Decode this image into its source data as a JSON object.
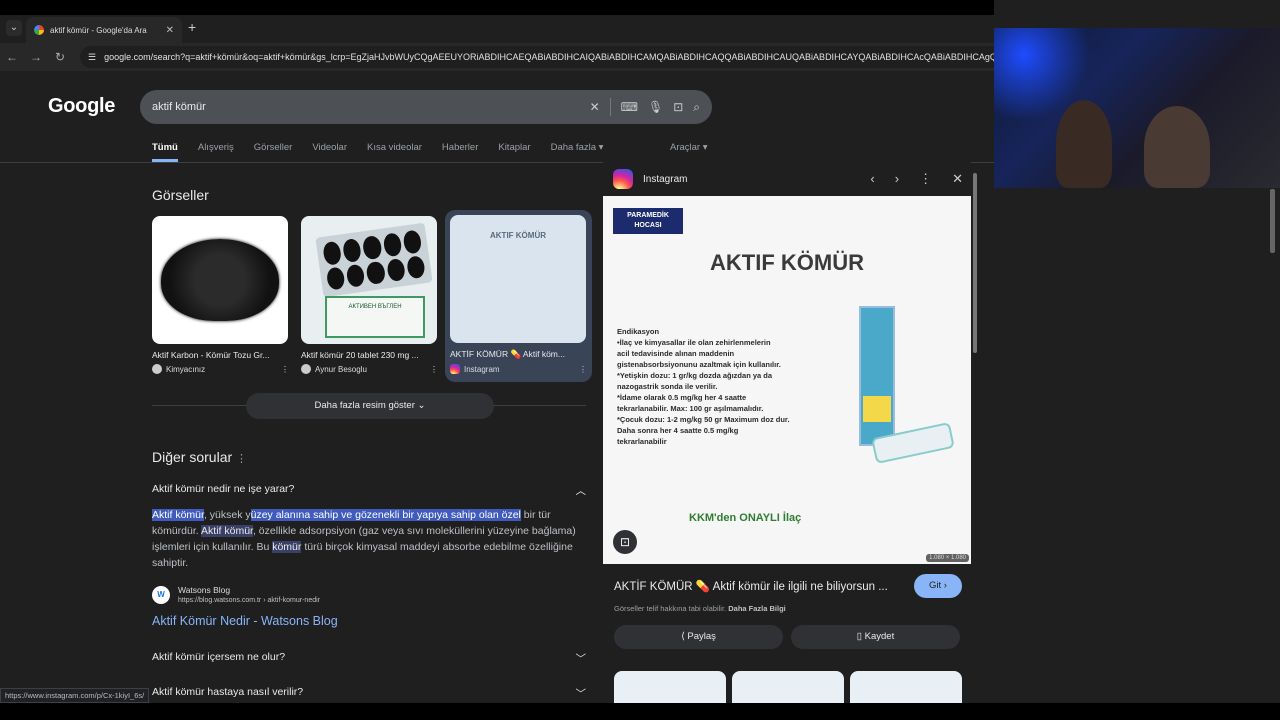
{
  "browser": {
    "tab_title": "aktif kömür - Google'da Ara",
    "url": "google.com/search?q=aktif+kömür&oq=aktif+kömür&gs_lcrp=EgZjaHJvbWUyCQgAEEUYORiABDIHCAEQABiABDIHCAIQABiABDIHCAMQABiABDIHCAQQABiABDIHCAUQABiABDIHCAYQABiABDIHCAcQABiABDIHCAgQABiABDIHCAkQABiABDIHCAoQABiABDIHCAsQABiABNIB"
  },
  "google": {
    "logo": "Google",
    "query": "aktif kömür",
    "filters": [
      "Tümü",
      "Alışveriş",
      "Görseller",
      "Videolar",
      "Kısa videolar",
      "Haberler",
      "Kitaplar",
      "Daha fazla ▾"
    ],
    "tools": "Araçlar ▾"
  },
  "images_section": {
    "heading": "Görseller",
    "cards": [
      {
        "title": "Aktif Karbon - Kömür Tozu Gr...",
        "source": "Kimyacınız"
      },
      {
        "title": "Aktif kömür 20 tablet 230 mg ...",
        "source": "Aynur Besoglu",
        "box_text": "АКТИВЕН ВЪГЛЕН"
      },
      {
        "title": "AKTİF KÖMÜR 💊 Aktif köm...",
        "source": "Instagram",
        "thumb_text": "AKTIF KÖMÜR"
      }
    ],
    "more_button": "Daha fazla resim göster ⌄"
  },
  "questions": {
    "heading": "Diğer sorular",
    "q1": "Aktif kömür nedir ne işe yarar?",
    "answer": {
      "a": "Aktif kömür",
      "b": ", yüksek y",
      "c": "üzey alanına sahip ve gözenekli bir yapıya sahip olan özel",
      "d": " bir tür kömürdür. ",
      "e": "Aktif kömür",
      "f": ", özellikle adsorpsiyon (gaz veya sıvı moleküllerini yüzeyine bağlama) işlemleri için kullanılır. Bu ",
      "g": "kömür",
      "h": " türü birçok kimyasal maddeyi absorbe edebilme özelliğine sahiptir."
    },
    "source_name": "Watsons Blog",
    "source_url": "https://blog.watsons.com.tr › aktif-komur-nedir",
    "source_link": "Aktif Kömür Nedir - Watsons Blog",
    "q2": "Aktif kömür içersem ne olur?",
    "q3": "Aktif kömür hastaya nasıl verilir?"
  },
  "panel": {
    "site": "Instagram",
    "badge": "PARAMEDİK HOCASI",
    "image_title": "AKTIF KÖMÜR",
    "image_text": [
      "Endikasyon",
      "•İlaç ve kimyasallar ile olan zehirlenmelerin",
      "acil tedavisinde alınan maddenin",
      "gistenabsorbsiyonunu azaltmak için kullanılır.",
      "*Yetişkin dozu: 1 gr/kg dozda ağızdan ya da",
      "nazogastrik sonda ile verilir.",
      "*İdame olarak 0.5 mg/kg her 4 saatte",
      "tekrarlanabilir. Max: 100 gr aşılmamalıdır.",
      "*Çocuk dozu: 1-2 mg/kg 50 gr Maximum doz dur.",
      "Daha sonra her 4 saatte 0.5 mg/kg",
      "tekrarlanabilir"
    ],
    "kkm": "KKM'den ONAYLI İlaç",
    "dimensions": "1.080 × 1.080",
    "title": "AKTİF KÖMÜR 💊 Aktif kömür ile ilgili ne biliyorsun ...",
    "visit": "Git ›",
    "copyright": "Görseller telif hakkına tabi olabilir.",
    "learn_more": "Daha Fazla Bilgi",
    "share": "⟨ Paylaş",
    "save": "▯ Kaydet"
  },
  "status_url": "https://www.instagram.com/p/Cx-1kiyI_6s/"
}
